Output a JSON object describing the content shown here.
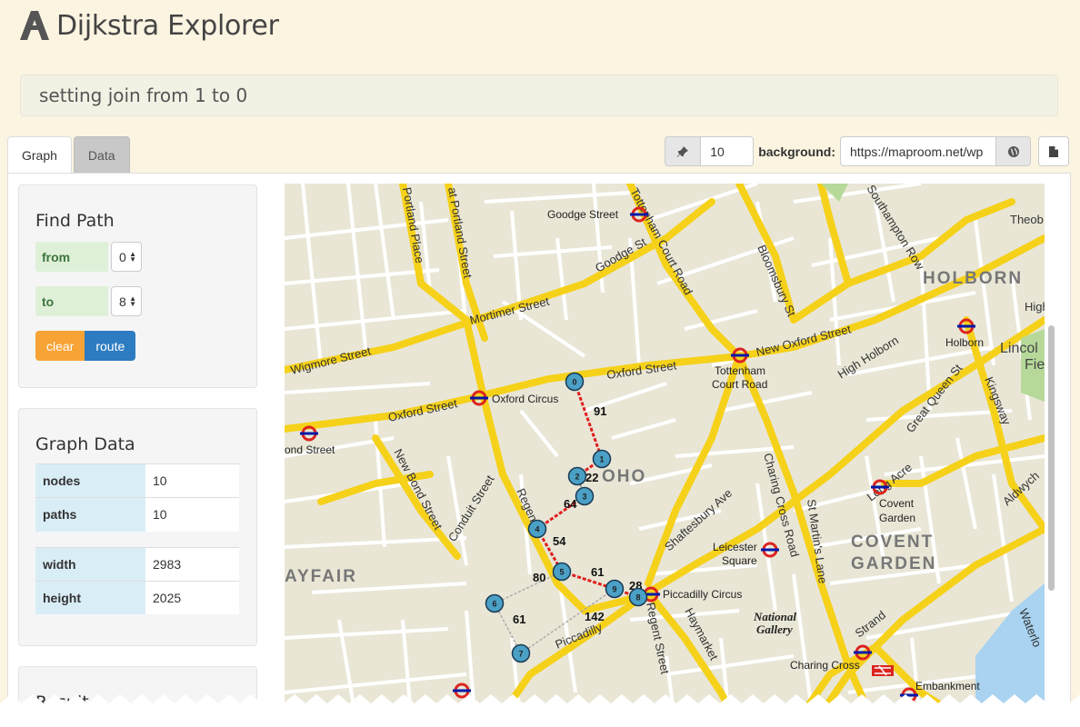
{
  "app": {
    "title": "Dijkstra Explorer"
  },
  "status": {
    "message": "setting join from 1 to 0"
  },
  "tabs": [
    {
      "label": "Graph"
    },
    {
      "label": "Data"
    }
  ],
  "toolbar": {
    "pin_value": "10",
    "background_label": "background:",
    "background_url": "https://maproom.net/wp"
  },
  "find_path": {
    "title": "Find Path",
    "from_label": "from",
    "from_value": "0",
    "to_label": "to",
    "to_value": "8",
    "clear_label": "clear",
    "route_label": "route"
  },
  "graph_data": {
    "title": "Graph Data",
    "nodes_label": "nodes",
    "nodes_value": "10",
    "paths_label": "paths",
    "paths_value": "10",
    "width_label": "width",
    "width_value": "2983",
    "height_label": "height",
    "height_value": "2025"
  },
  "result": {
    "title": "Result"
  },
  "map": {
    "labels": {
      "goodge": "Goodge Street",
      "holborn_area": "HOLBORN",
      "holborn": "Holborn",
      "lincoln": "Lincol",
      "fie": "Fie",
      "tottenham1": "Tottenham",
      "tottenham2": "Court Road",
      "oxford_circus": "Oxford Circus",
      "bond": "ond Street",
      "soho": "OHO",
      "covent1": "Covent",
      "covent2": "Garden",
      "covent_area1": "COVENT",
      "covent_area2": "GARDEN",
      "leicester1": "Leicester",
      "leicester2": "Square",
      "mayfair": "AYFAIR",
      "piccadilly": "Piccadilly Circus",
      "national1": "National",
      "national2": "Gallery",
      "charing": "Charing Cross",
      "embankment": "Embankment",
      "s_portland": "Portland Place",
      "s_gtportland": "at Portland Street",
      "s_tottenham": "Tottenham Court Road",
      "s_southampton": "Southampton Row",
      "s_theob": "Theob",
      "s_goodge": "Goodge St",
      "s_mortimer": "Mortimer Street",
      "s_bloomsbury": "Bloomsbury St",
      "s_newoxford": "New Oxford Street",
      "s_high": "High",
      "s_wigmore": "Wigmore Street",
      "s_oxford1": "Oxford Street",
      "s_oxford2": "Oxford Street",
      "s_highholborn": "High Holborn",
      "s_greatqueen": "Great Queen St",
      "s_kingsway": "Kingsway",
      "s_newbond": "New Bond Street",
      "s_conduit": "Conduit Street",
      "s_regent": "Regent",
      "s_charingcross": "Charing Cross Road",
      "s_stmartins": "St Martin's Lane",
      "s_shaftesbury": "Shaftesbury Ave",
      "s_longacre": "Long Acre",
      "s_aldwych": "Aldwych",
      "s_regent2": "Regent Street",
      "s_haymarket": "Haymarket",
      "s_piccadilly": "Piccadilly",
      "s_strand": "Strand",
      "s_waterloo": "Waterlo"
    },
    "nodes": [
      {
        "id": "0"
      },
      {
        "id": "1"
      },
      {
        "id": "2"
      },
      {
        "id": "3"
      },
      {
        "id": "4"
      },
      {
        "id": "5"
      },
      {
        "id": "6"
      },
      {
        "id": "7"
      },
      {
        "id": "8"
      },
      {
        "id": "9"
      }
    ],
    "weights": [
      "91",
      "22",
      "64",
      "54",
      "61",
      "28",
      "80",
      "61",
      "142"
    ]
  }
}
